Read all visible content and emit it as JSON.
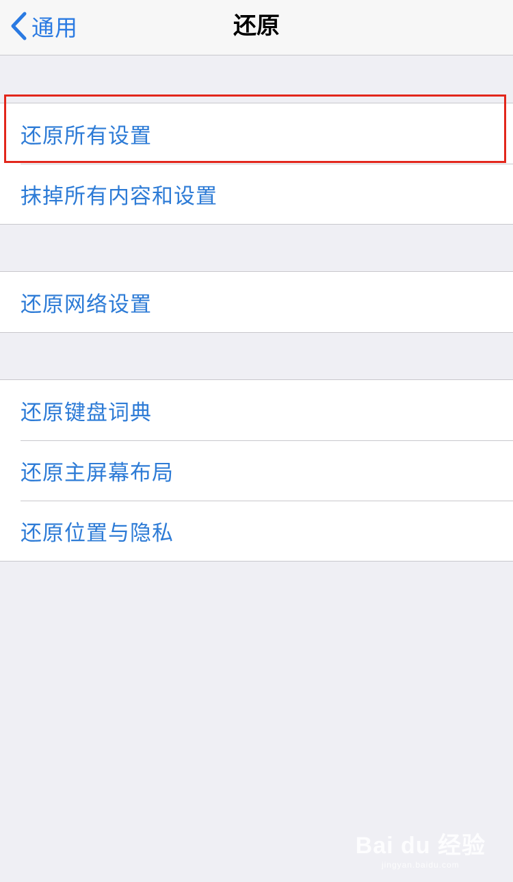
{
  "navbar": {
    "back_label": "通用",
    "title": "还原"
  },
  "groups": [
    {
      "items": [
        "还原所有设置",
        "抹掉所有内容和设置"
      ]
    },
    {
      "items": [
        "还原网络设置"
      ]
    },
    {
      "items": [
        "还原键盘词典",
        "还原主屏幕布局",
        "还原位置与隐私"
      ]
    }
  ],
  "highlighted_item": "还原所有设置",
  "watermark": {
    "text": "Bai du 经验",
    "sub": "jingyan.baidu.com"
  },
  "colors": {
    "accent": "#2d7bd6",
    "highlight_border": "#e2261b",
    "background": "#efeff4"
  }
}
